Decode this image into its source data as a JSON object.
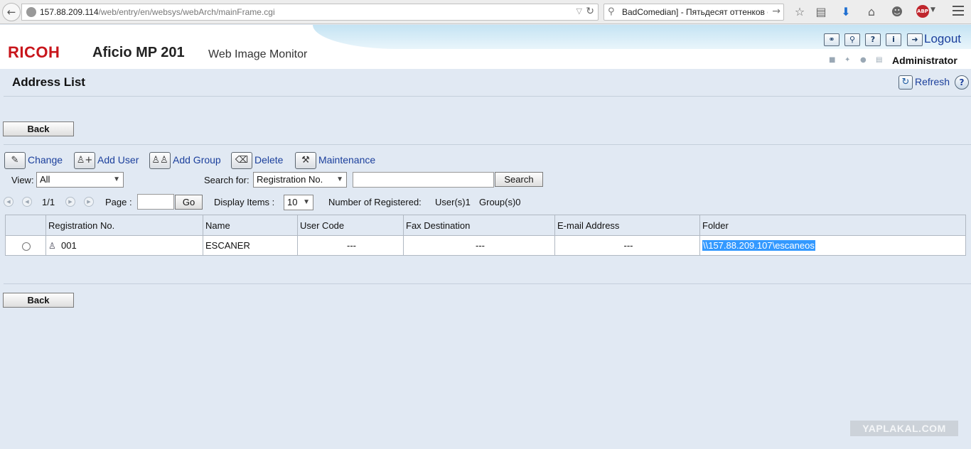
{
  "browser": {
    "url_host": "157.88.209.114",
    "url_path": "/web/entry/en/websys/webArch/mainFrame.cgi",
    "search_query": "BadComedian] - Пятьдесят оттенков с",
    "abp_label": "ABP"
  },
  "header": {
    "logo": "RICOH",
    "product": "Aficio MP 201",
    "app_name": "Web Image Monitor",
    "logout": "Logout",
    "user": "Administrator",
    "brand_color": "#c8151b",
    "link_color": "#1b3f9c"
  },
  "page": {
    "title": "Address List",
    "refresh": "Refresh",
    "back_label": "Back"
  },
  "toolbar": {
    "change": "Change",
    "add_user": "Add User",
    "add_group": "Add Group",
    "delete": "Delete",
    "maintenance": "Maintenance"
  },
  "filters": {
    "view_label": "View:",
    "view_value": "All",
    "search_for_label": "Search for:",
    "search_for_value": "Registration No.",
    "search_text": "",
    "search_button": "Search"
  },
  "paging": {
    "current": "1/1",
    "page_label": "Page :",
    "page_value": "",
    "go_button": "Go",
    "display_items_label": "Display Items :",
    "display_items_value": "10",
    "registered_label": "Number of Registered:",
    "users": "User(s)1",
    "groups": "Group(s)0"
  },
  "table": {
    "headers": [
      "Registration No.",
      "Name",
      "User Code",
      "Fax Destination",
      "E-mail Address",
      "Folder"
    ],
    "rows": [
      {
        "registration_no": "001",
        "name": "ESCANER",
        "user_code": "---",
        "fax_destination": "---",
        "email": "---",
        "folder": "\\\\157.88.209.107\\escaneos"
      }
    ]
  },
  "watermark": "YAPLAKAL.COM"
}
